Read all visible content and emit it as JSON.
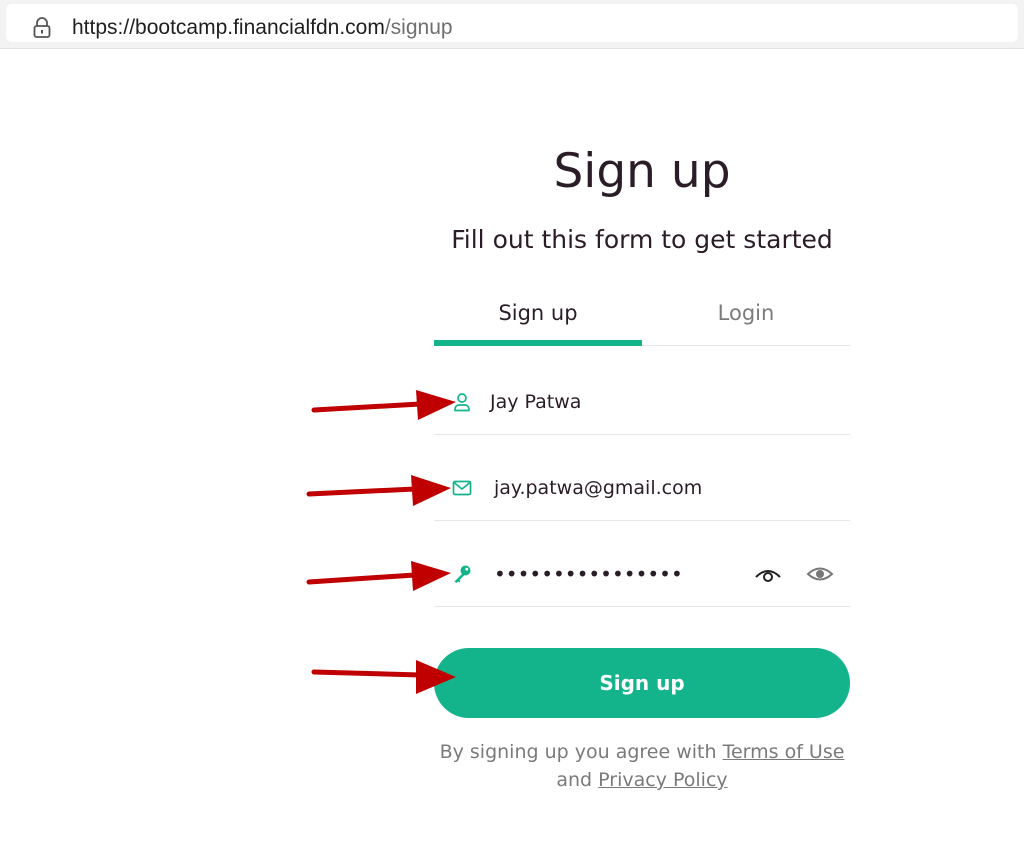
{
  "browser": {
    "url_domain": "https://bootcamp.financialfdn.com",
    "url_path": "/signup"
  },
  "page": {
    "title": "Sign up",
    "subtitle": "Fill out this form to get started"
  },
  "tabs": [
    {
      "label": "Sign up",
      "active": true
    },
    {
      "label": "Login",
      "active": false
    }
  ],
  "form": {
    "name_value": "Jay Patwa",
    "email_value": "jay.patwa@gmail.com",
    "password_mask": "••••••••••••••••",
    "submit_label": "Sign up"
  },
  "terms": {
    "prefix": "By signing up you agree with",
    "terms_link": "Terms of Use",
    "joiner": "and",
    "privacy_link": "Privacy Policy"
  },
  "colors": {
    "accent": "#13b38c",
    "annotation_arrow": "#c00000",
    "text": "#2b1d27",
    "muted": "#7a7a7a"
  },
  "icons": [
    "lock-icon",
    "user-icon",
    "envelope-icon",
    "key-icon",
    "eye-outline-icon",
    "eye-icon",
    "annotation-arrow"
  ]
}
